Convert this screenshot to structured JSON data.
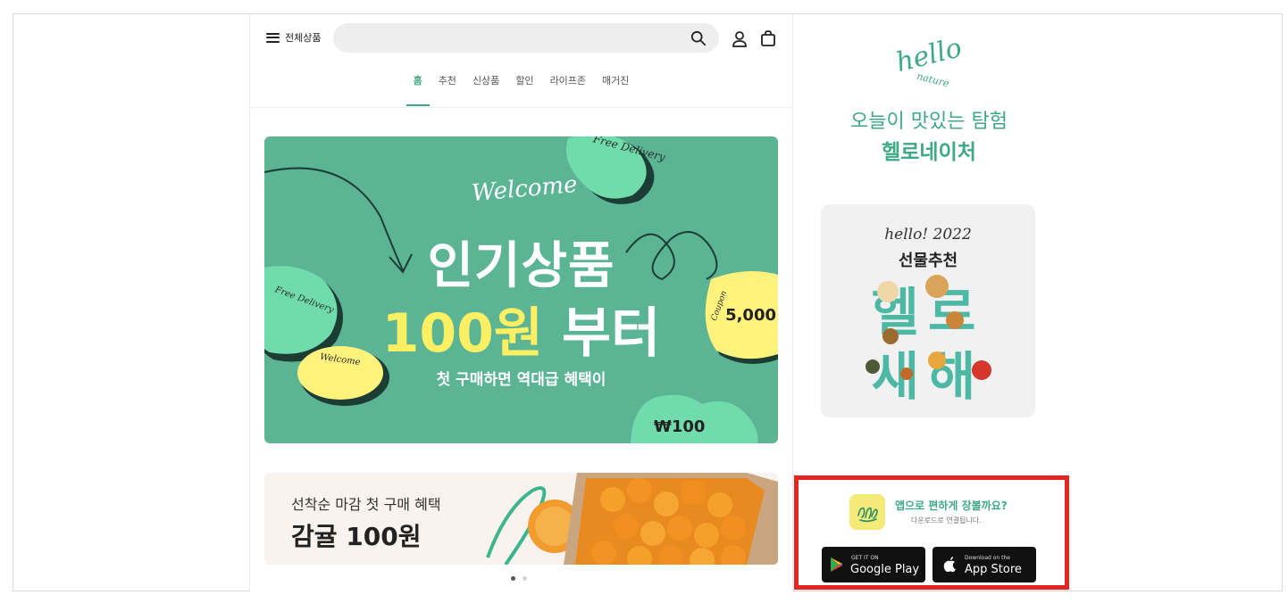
{
  "header": {
    "menu_label": "전체상품",
    "search_placeholder": ""
  },
  "tabs": [
    {
      "label": "홈",
      "active": true
    },
    {
      "label": "추천"
    },
    {
      "label": "신상품"
    },
    {
      "label": "할인"
    },
    {
      "label": "라이프존"
    },
    {
      "label": "매거진"
    }
  ],
  "hero": {
    "welcome": "Welcome",
    "title": "인기상품",
    "price_highlight": "100원",
    "price_suffix": "부터",
    "subtitle": "첫 구매하면 역대급 혜택이",
    "sticker_free_delivery_top": "Free Delivery",
    "sticker_free_delivery_left": "Free Delivery",
    "sticker_welcome_small": "Welcome",
    "coupon_label": "Coupon",
    "coupon_value": "5,000",
    "won_price": "₩100"
  },
  "promo_banner": {
    "subtitle": "선착순 마감 첫 구매 혜택",
    "title": "감귤 100원"
  },
  "carousel": {
    "pages": 2,
    "active": 0
  },
  "brand": {
    "logo_text_1": "hello",
    "logo_text_2": "nature",
    "slogan": "오늘이 맛있는 탐험",
    "name": "헬로네이처"
  },
  "gift_card": {
    "year_text": "hello! 2022",
    "title": "선물추천",
    "big_line_1": "헬로",
    "big_line_2": "새해"
  },
  "app_download": {
    "title": "앱으로 편하게 장볼까요?",
    "subtitle": "다운로드로 연결됩니다.",
    "google_small": "GET IT ON",
    "google_big": "Google Play",
    "apple_small": "Download on the",
    "apple_big": "App Store"
  },
  "colors": {
    "brand_green": "#3ea982",
    "hero_green": "#5bb595",
    "highlight_yellow": "#ffef63",
    "alert_red": "#e5251f"
  }
}
